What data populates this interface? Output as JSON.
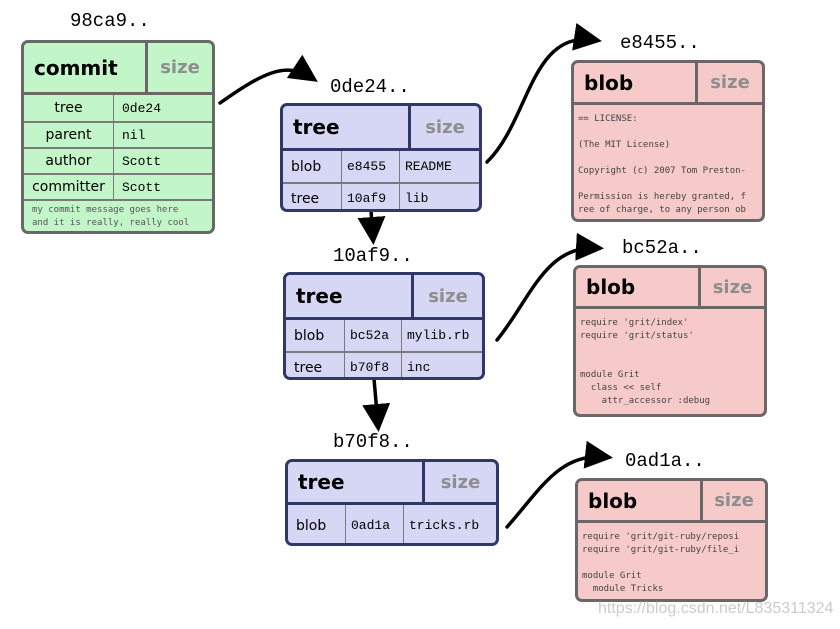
{
  "commit": {
    "hash": "98ca9..",
    "type": "commit",
    "size": "size",
    "rows": [
      {
        "key": "tree",
        "value": "0de24"
      },
      {
        "key": "parent",
        "value": "nil"
      },
      {
        "key": "author",
        "value": "Scott"
      },
      {
        "key": "committer",
        "value": "Scott"
      }
    ],
    "message": [
      "my commit message goes here",
      "and it is really, really cool"
    ]
  },
  "trees": [
    {
      "hash": "0de24..",
      "type": "tree",
      "size": "size",
      "entries": [
        {
          "kind": "blob",
          "sha": "e8455",
          "name": "README"
        },
        {
          "kind": "tree",
          "sha": "10af9",
          "name": "lib"
        }
      ]
    },
    {
      "hash": "10af9..",
      "type": "tree",
      "size": "size",
      "entries": [
        {
          "kind": "blob",
          "sha": "bc52a",
          "name": "mylib.rb"
        },
        {
          "kind": "tree",
          "sha": "b70f8",
          "name": "inc"
        }
      ]
    },
    {
      "hash": "b70f8..",
      "type": "tree",
      "size": "size",
      "entries": [
        {
          "kind": "blob",
          "sha": "0ad1a",
          "name": "tricks.rb"
        }
      ]
    }
  ],
  "blobs": [
    {
      "hash": "e8455..",
      "type": "blob",
      "size": "size",
      "content": "== LICENSE:\n\n(The MIT License)\n\nCopyright (c) 2007 Tom Preston-\n\nPermission is hereby granted, f\nree of charge, to any person ob"
    },
    {
      "hash": "bc52a..",
      "type": "blob",
      "size": "size",
      "content": "require 'grit/index'\nrequire 'grit/status'\n\n\nmodule Grit\n  class << self\n    attr_accessor :debug"
    },
    {
      "hash": "0ad1a..",
      "type": "blob",
      "size": "size",
      "content": "require 'grit/git-ruby/reposi\nrequire 'grit/git-ruby/file_i\n\nmodule Grit\n  module Tricks"
    }
  ],
  "watermark": "https://blog.csdn.net/L835311324",
  "colors": {
    "commit": "#c2f5c8",
    "tree": "#d6d6f5",
    "blob": "#f5cac8",
    "tree_border": "#2f3868",
    "border": "#6b6668"
  }
}
